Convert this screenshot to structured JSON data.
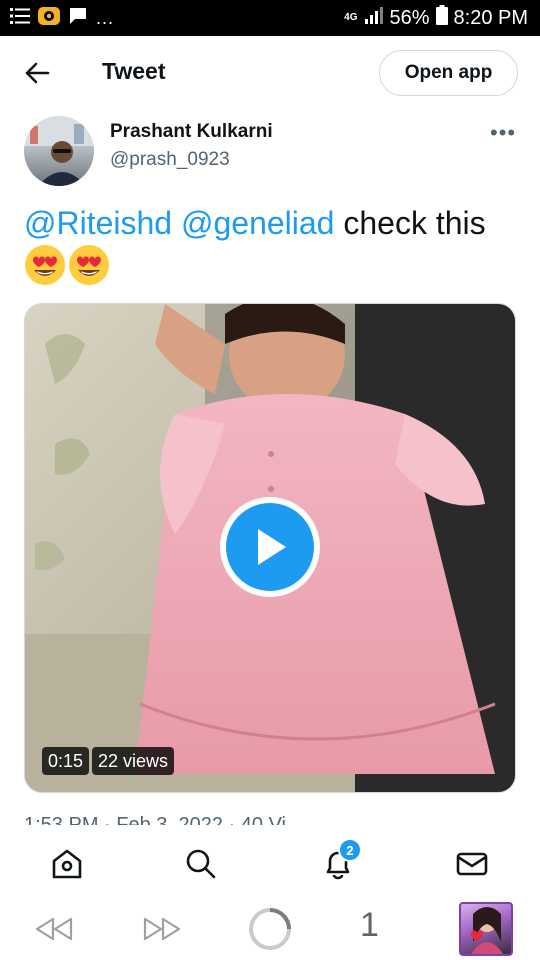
{
  "status_bar": {
    "network": "4G",
    "battery": "56%",
    "time": "8:20 PM",
    "overflow": "..."
  },
  "header": {
    "title": "Tweet",
    "open_app": "Open app"
  },
  "author": {
    "name": "Prashant Kulkarni",
    "handle": "@prash_0923",
    "more": "•••"
  },
  "tweet": {
    "mention_1": "@Riteishd",
    "mention_2": "@geneliad",
    "text": "check this",
    "emojis": [
      "heart-eyes",
      "heart-eyes"
    ]
  },
  "media": {
    "duration": "0:15",
    "views": "22 views"
  },
  "meta_line": "1:53 PM · Feb 3, 2022 · 40 Vi",
  "bottom_nav": {
    "items": [
      "home-icon",
      "search-icon",
      "notifications-icon",
      "messages-icon"
    ],
    "notification_count": "2"
  },
  "browser_nav": {
    "tab_count": "1"
  },
  "colors": {
    "accent": "#1d9bf0",
    "text": "#0f1419",
    "secondary": "#536471",
    "border": "#cfd9de"
  }
}
